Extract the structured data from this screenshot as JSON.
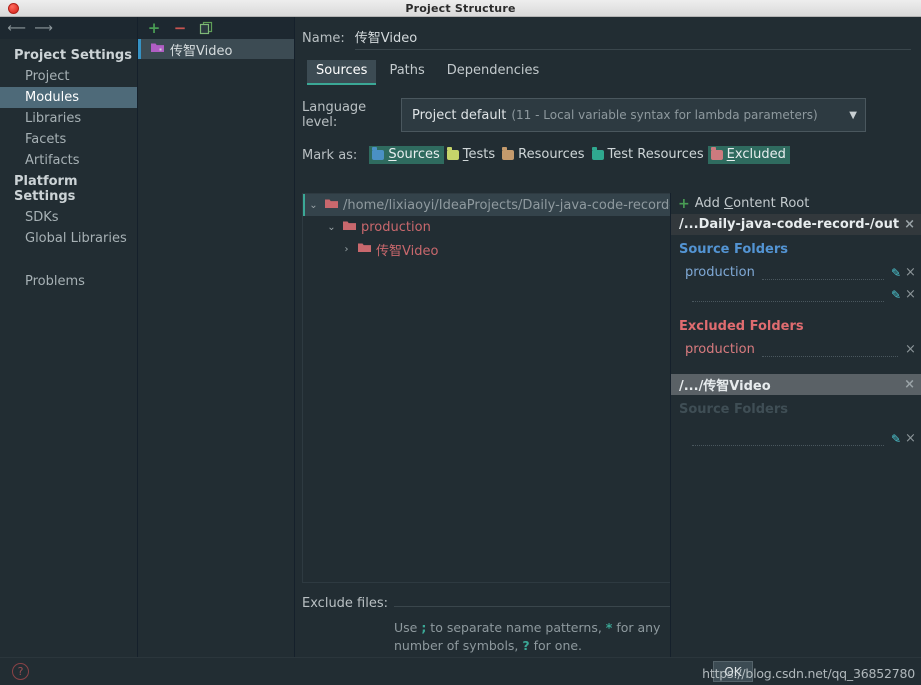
{
  "window": {
    "title": "Project Structure",
    "close_icon": "close-circle-icon"
  },
  "nav": {
    "back_icon": "arrow-left-icon",
    "forward_icon": "arrow-right-icon"
  },
  "sidebar": {
    "groups": [
      {
        "label": "Project Settings",
        "items": [
          "Project",
          "Modules",
          "Libraries",
          "Facets",
          "Artifacts"
        ]
      },
      {
        "label": "Platform Settings",
        "items": [
          "SDKs",
          "Global Libraries"
        ]
      }
    ],
    "selected": "Modules",
    "problems": "Problems"
  },
  "modules": {
    "toolbar": {
      "add": "+",
      "remove": "−",
      "copy_icon": "copy-icon"
    },
    "items": [
      {
        "label": "传智Video",
        "icon": "module-folder-icon",
        "selected": true
      }
    ]
  },
  "editor": {
    "name_label": "Name:",
    "name_value": "传智Video",
    "tabs": [
      {
        "label": "Sources",
        "active": true
      },
      {
        "label": "Paths",
        "active": false
      },
      {
        "label": "Dependencies",
        "active": false
      }
    ],
    "language_level": {
      "label": "Language level:",
      "value": "Project default",
      "detail": "(11 - Local variable syntax for lambda parameters)",
      "caret_icon": "chevron-down-icon"
    },
    "mark_as": {
      "label": "Mark as:",
      "options": [
        {
          "label": "Sources",
          "mnemonic": "S",
          "color": "#4a90c4",
          "selected": true
        },
        {
          "label": "Tests",
          "mnemonic": "T",
          "color": "#c5d46a",
          "selected": false
        },
        {
          "label": "Resources",
          "mnemonic": "",
          "color": "#c49a6c",
          "selected": false
        },
        {
          "label": "Test Resources",
          "mnemonic": "",
          "color": "#2fa88f",
          "selected": false
        },
        {
          "label": "Excluded",
          "mnemonic": "E",
          "color": "#cc7a7e",
          "selected": true
        }
      ]
    },
    "tree": [
      {
        "label": "/home/lixiaoyi/IdeaProjects/Daily-java-code-record-/out",
        "indent": 0,
        "twisty": "⌄",
        "expanded": true,
        "selected": true,
        "color": "grey"
      },
      {
        "label": "production",
        "indent": 1,
        "twisty": "⌄",
        "expanded": true,
        "selected": false,
        "color": "red"
      },
      {
        "label": "传智Video",
        "indent": 2,
        "twisty": "›",
        "expanded": false,
        "selected": false,
        "color": "red"
      }
    ],
    "exclude": {
      "label": "Exclude files:",
      "value": "",
      "hint_parts": [
        "Use ",
        ";",
        " to separate name patterns, ",
        "*",
        " for any number of symbols, ",
        "?",
        " for one."
      ]
    }
  },
  "roots_panel": {
    "add_content_root": "Add Content Root",
    "add_icon": "plus-icon",
    "roots": [
      {
        "title": "/...Daily-java-code-record-/out",
        "active": false,
        "close_icon": "×",
        "sections": [
          {
            "title": "Source Folders",
            "kind": "source",
            "folders": [
              {
                "name": "production",
                "edit_icon": "pencil-icon",
                "remove_icon": "×"
              },
              {
                "name": "",
                "edit_icon": "pencil-icon",
                "remove_icon": "×"
              }
            ]
          },
          {
            "title": "Excluded Folders",
            "kind": "excluded",
            "folders": [
              {
                "name": "production",
                "edit_icon": "",
                "remove_icon": "×"
              }
            ]
          }
        ]
      },
      {
        "title": "/.../传智Video",
        "active": true,
        "close_icon": "×",
        "sections": [
          {
            "title": "Source Folders",
            "kind": "faded",
            "folders": [
              {
                "name": "",
                "edit_icon": "pencil-icon",
                "remove_icon": "×"
              }
            ]
          }
        ]
      }
    ]
  },
  "footer": {
    "help_icon": "help-icon",
    "help_glyph": "?",
    "ok_label": "OK",
    "watermark": "https://blog.csdn.net/qq_36852780"
  }
}
